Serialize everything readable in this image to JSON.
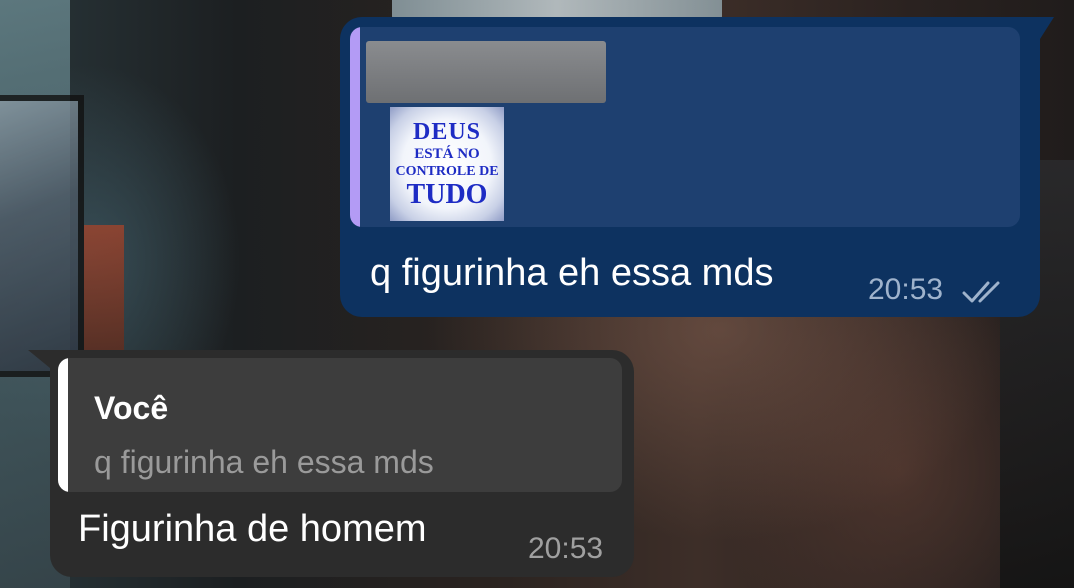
{
  "outgoing": {
    "reply_preview": {
      "sender": "",
      "sticker_lines": [
        "DEUS",
        "ESTÁ NO",
        "CONTROLE DE",
        "TUDO"
      ]
    },
    "text": "q figurinha eh essa mds",
    "time": "20:53",
    "status_icon": "double-check-icon"
  },
  "incoming": {
    "reply_preview": {
      "sender": "Você",
      "text": "q figurinha eh essa mds"
    },
    "text": "Figurinha de homem",
    "time": "20:53"
  },
  "colors": {
    "outgoing_bubble": "#0d3260",
    "outgoing_reply_bar": "#b39bf5",
    "incoming_bubble": "#2c2c2c",
    "incoming_reply_bar": "#ffffff"
  }
}
